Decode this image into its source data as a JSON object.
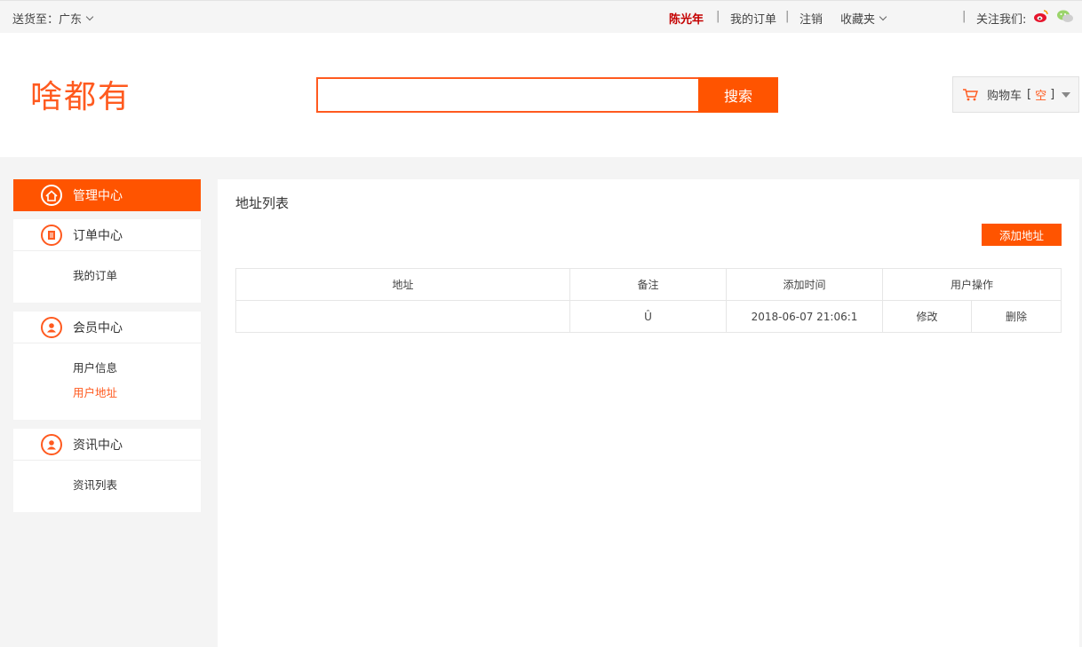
{
  "topbar": {
    "ship_to": "送货至：广东",
    "user_name": "陈光年",
    "my_orders": "我的订单",
    "logout": "注销",
    "favorites": "收藏夹",
    "follow_us": "关注我们:",
    "separator": "|"
  },
  "header": {
    "logo": "啥都有",
    "search_placeholder": "",
    "search_button": "搜索",
    "cart_label": "购物车",
    "cart_open": "[",
    "cart_status": "空",
    "cart_close": "]"
  },
  "sidebar": {
    "admin_center": "管理中心",
    "order_center": "订单中心",
    "order_items": [
      "我的订单"
    ],
    "member_center": "会员中心",
    "member_items": [
      "用户信息",
      "用户地址"
    ],
    "news_center": "资讯中心",
    "news_items": [
      "资讯列表"
    ]
  },
  "main": {
    "title": "地址列表",
    "add_button": "添加地址",
    "columns": [
      "地址",
      "备注",
      "添加时间",
      "用户操作"
    ],
    "rows": [
      {
        "address": "",
        "note": "Û",
        "time": "2018-06-07 21:06:1",
        "edit": "修改",
        "delete": "删除"
      }
    ]
  },
  "colors": {
    "accent": "#ff5400",
    "user_name": "#c40000"
  }
}
